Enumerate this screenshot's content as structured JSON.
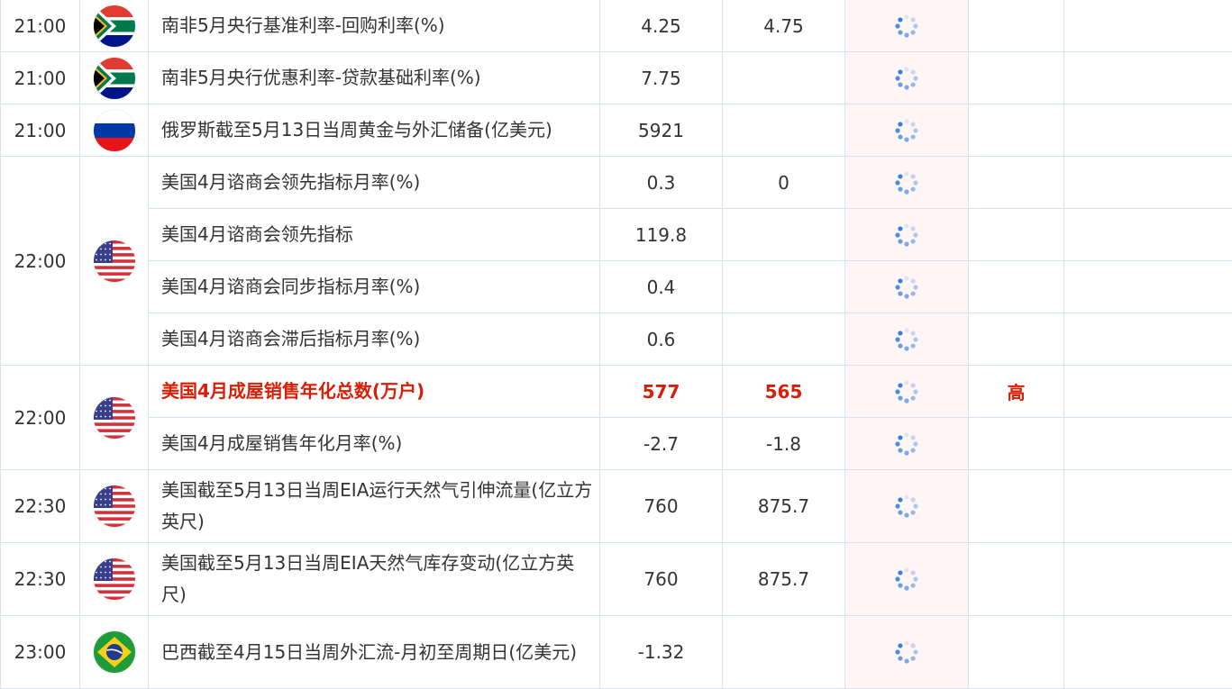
{
  "rows": [
    {
      "time": "21:00",
      "flag": "south-africa",
      "flag_rows": 1,
      "time_rows": 1,
      "event": "南非5月央行基准利率-回购利率(%)",
      "previous": "4.25",
      "forecast": "4.75",
      "level": "",
      "highlight": false,
      "h": 58
    },
    {
      "time": "21:00",
      "flag": "south-africa",
      "flag_rows": 1,
      "time_rows": 1,
      "event": "南非5月央行优惠利率-贷款基础利率(%)",
      "previous": "7.75",
      "forecast": "",
      "level": "",
      "highlight": false,
      "h": 58
    },
    {
      "time": "21:00",
      "flag": "russia",
      "flag_rows": 1,
      "time_rows": 1,
      "event": "俄罗斯截至5月13日当周黄金与外汇储备(亿美元)",
      "previous": "5921",
      "forecast": "",
      "level": "",
      "highlight": false,
      "h": 58
    },
    {
      "time": "22:00",
      "flag": "usa",
      "flag_rows": 4,
      "time_rows": 4,
      "event": "美国4月谘商会领先指标月率(%)",
      "previous": "0.3",
      "forecast": "0",
      "level": "",
      "highlight": false,
      "h": 58
    },
    {
      "time": "",
      "flag": "",
      "flag_rows": 0,
      "time_rows": 0,
      "event": "美国4月谘商会领先指标",
      "previous": "119.8",
      "forecast": "",
      "level": "",
      "highlight": false,
      "h": 58
    },
    {
      "time": "",
      "flag": "",
      "flag_rows": 0,
      "time_rows": 0,
      "event": "美国4月谘商会同步指标月率(%)",
      "previous": "0.4",
      "forecast": "",
      "level": "",
      "highlight": false,
      "h": 58
    },
    {
      "time": "",
      "flag": "",
      "flag_rows": 0,
      "time_rows": 0,
      "event": "美国4月谘商会滞后指标月率(%)",
      "previous": "0.6",
      "forecast": "",
      "level": "",
      "highlight": false,
      "h": 58
    },
    {
      "time": "22:00",
      "flag": "usa",
      "flag_rows": 2,
      "time_rows": 2,
      "event": "美国4月成屋销售年化总数(万户)",
      "previous": "577",
      "forecast": "565",
      "level": "高",
      "highlight": true,
      "h": 58
    },
    {
      "time": "",
      "flag": "",
      "flag_rows": 0,
      "time_rows": 0,
      "event": "美国4月成屋销售年化月率(%)",
      "previous": "-2.7",
      "forecast": "-1.8",
      "level": "",
      "highlight": false,
      "h": 58
    },
    {
      "time": "22:30",
      "flag": "usa",
      "flag_rows": 1,
      "time_rows": 1,
      "event": "美国截至5月13日当周EIA运行天然气引伸流量(亿立方英尺)",
      "previous": "760",
      "forecast": "875.7",
      "level": "",
      "highlight": false,
      "h": 81
    },
    {
      "time": "22:30",
      "flag": "usa",
      "flag_rows": 1,
      "time_rows": 1,
      "event": "美国截至5月13日当周EIA天然气库存变动(亿立方英尺)",
      "previous": "760",
      "forecast": "875.7",
      "level": "",
      "highlight": false,
      "h": 81
    },
    {
      "time": "23:00",
      "flag": "brazil",
      "flag_rows": 1,
      "time_rows": 1,
      "event": "巴西截至4月15日当周外汇流-月初至周期日(亿美元)",
      "previous": "-1.32",
      "forecast": "",
      "level": "",
      "highlight": false,
      "h": 81
    }
  ],
  "colors": {
    "border": "#d6e2ef",
    "highlight_text": "#d81e06",
    "actual_bg": "#fff5f5",
    "spinner": "#2f7de1"
  }
}
